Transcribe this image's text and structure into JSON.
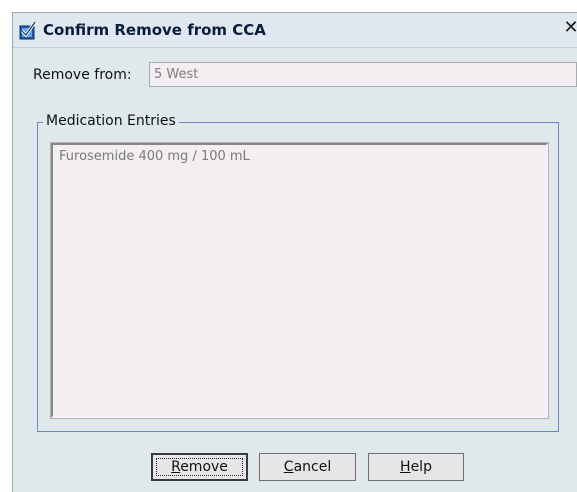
{
  "window": {
    "title": "Confirm Remove from CCA",
    "close_glyph": "✕",
    "icon": "checkmark-icon"
  },
  "remove_from": {
    "label": "Remove from:",
    "value": "5 West"
  },
  "medication_entries": {
    "legend": "Medication Entries",
    "items": [
      "Furosemide 400 mg / 100 mL"
    ]
  },
  "buttons": {
    "remove": {
      "prefix": "",
      "accel": "R",
      "rest": "emove"
    },
    "cancel": {
      "prefix": "",
      "accel": "C",
      "rest": "ancel"
    },
    "help": {
      "prefix": "",
      "accel": "H",
      "rest": "elp"
    }
  }
}
